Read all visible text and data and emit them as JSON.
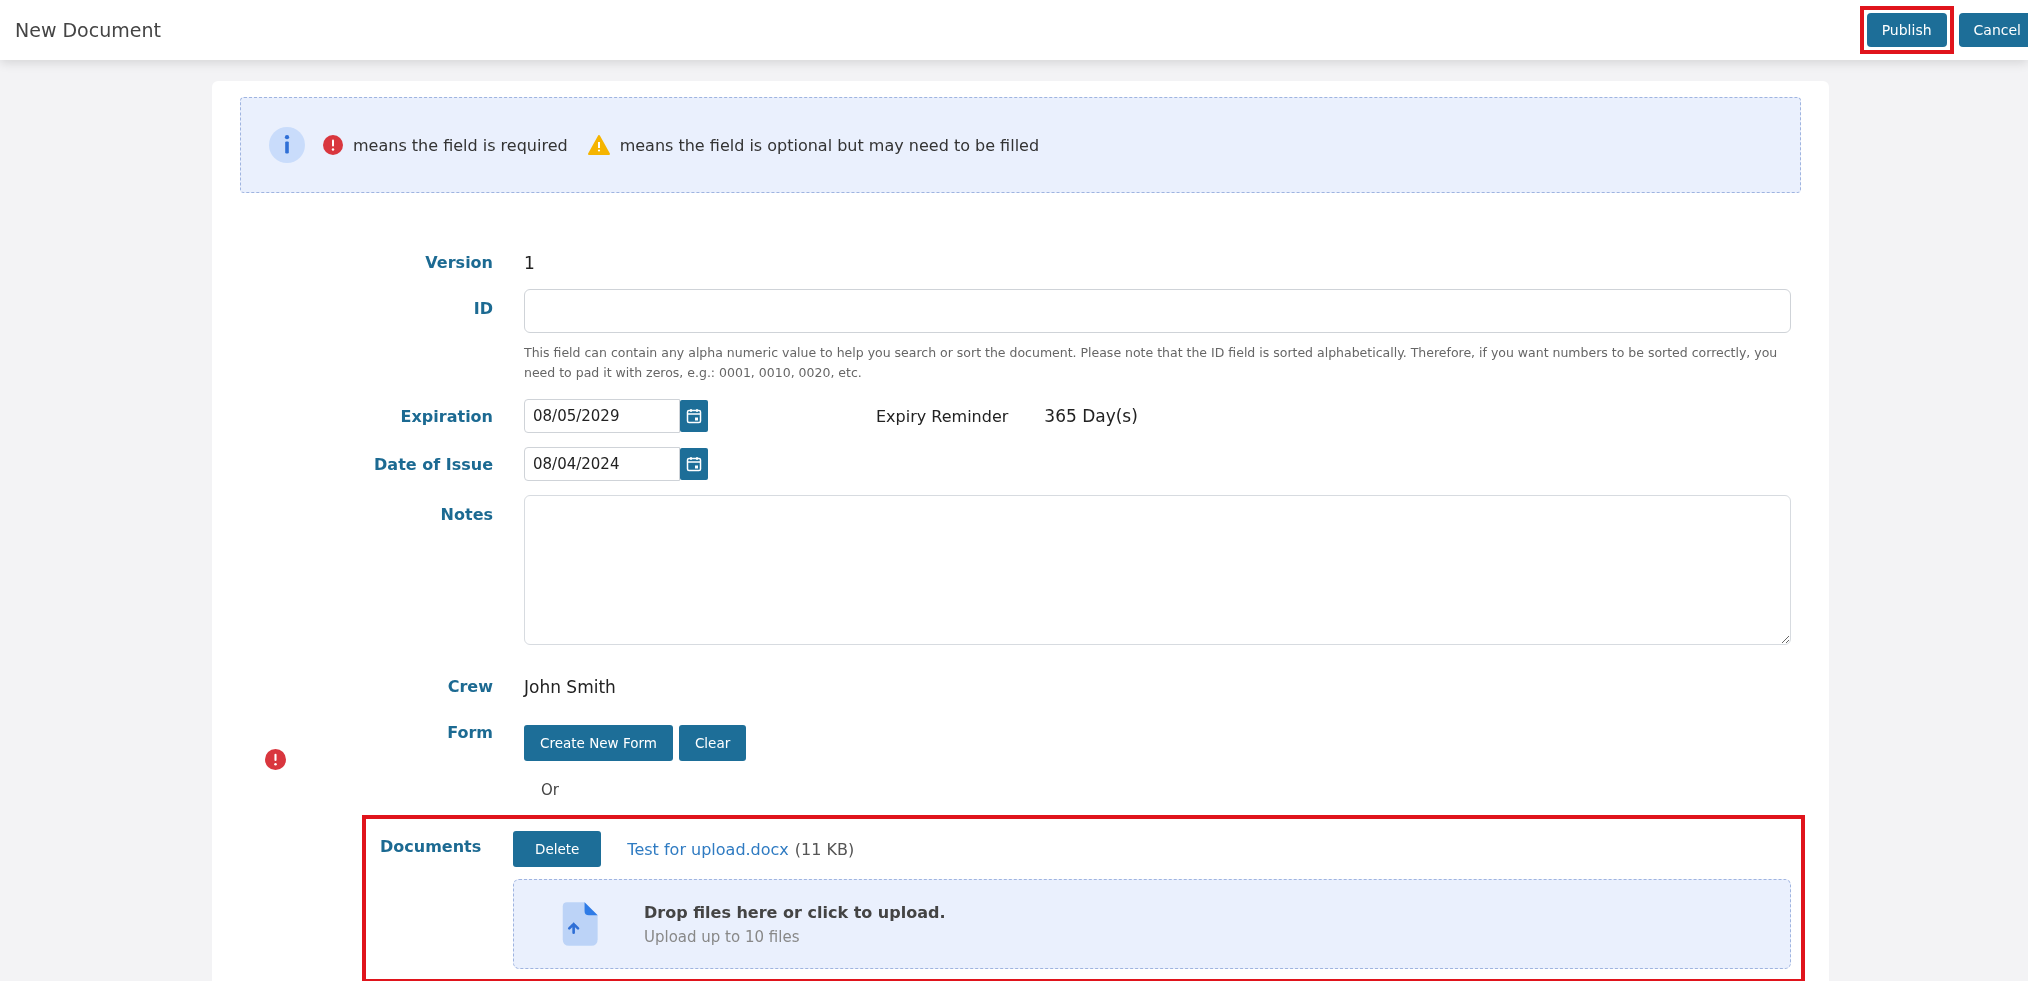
{
  "header": {
    "title": "New Document",
    "buttons": [
      {
        "label": "Publish",
        "highlighted": true
      },
      {
        "label": "Cancel",
        "highlighted": false
      }
    ]
  },
  "legend": {
    "required_text": "means the field is required",
    "optional_text": "means the field is optional but may need to be filled"
  },
  "fields": [
    {
      "kind": "text",
      "label": "Version",
      "value": "1"
    },
    {
      "kind": "input",
      "label": "ID",
      "help": "This field can contain any alpha numeric value to help you search or sort the document. Please note that the ID field is sorted alphabetically. Therefore, if you want numbers to be sorted correctly, you need to pad it with zeros, e.g.: 0001, 0010, 0020, etc."
    },
    {
      "kind": "date",
      "label": "Expiration",
      "value": "08/05/2029",
      "side_label": "Expiry Reminder",
      "side_value": "365 Day(s)"
    },
    {
      "kind": "date",
      "label": "Date of Issue",
      "value": "08/04/2024"
    },
    {
      "kind": "textarea",
      "label": "Notes"
    },
    {
      "kind": "text",
      "label": "Crew",
      "value": "John Smith"
    },
    {
      "kind": "buttons",
      "label": "Form",
      "required": true,
      "buttons": [
        "Create New Form",
        "Clear"
      ],
      "note": "Or"
    }
  ],
  "documents": {
    "label": "Documents",
    "highlighted": true,
    "files": [
      {
        "action": "Delete",
        "name": "Test for upload.docx",
        "size": "(11 KB)"
      }
    ],
    "dropzone": {
      "title": "Drop files here or click to upload.",
      "subtitle": "Upload up to 10 files"
    }
  }
}
